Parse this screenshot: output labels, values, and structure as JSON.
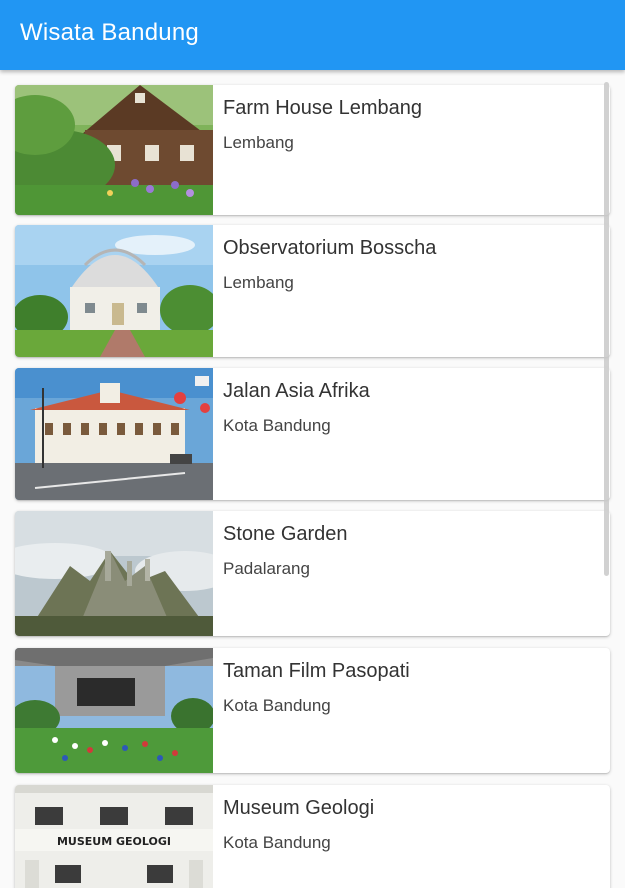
{
  "app_bar": {
    "title": "Wisata Bandung"
  },
  "places": [
    {
      "name": "Farm House Lembang",
      "location": "Lembang"
    },
    {
      "name": "Observatorium Bosscha",
      "location": "Lembang"
    },
    {
      "name": "Jalan Asia Afrika",
      "location": "Kota Bandung"
    },
    {
      "name": "Stone Garden",
      "location": "Padalarang"
    },
    {
      "name": "Taman Film Pasopati",
      "location": "Kota Bandung"
    },
    {
      "name": "Museum Geologi",
      "location": "Kota Bandung",
      "sign_text": "MUSEUM GEOLOGI"
    }
  ],
  "colors": {
    "app_bar": "#2196f3",
    "background": "#fafafa",
    "card": "#ffffff"
  }
}
